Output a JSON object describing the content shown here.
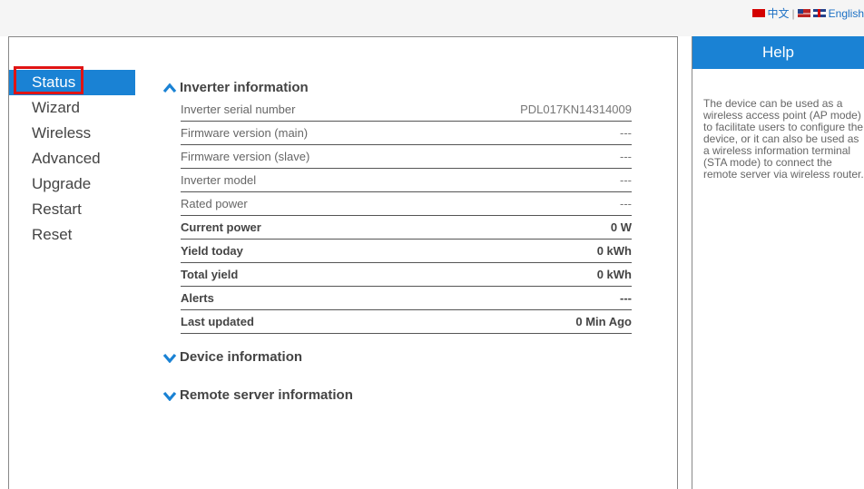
{
  "language": {
    "chinese": "中文",
    "separator": "|",
    "english": "English"
  },
  "nav": {
    "items": [
      {
        "label": "Status"
      },
      {
        "label": "Wizard"
      },
      {
        "label": "Wireless"
      },
      {
        "label": "Advanced"
      },
      {
        "label": "Upgrade"
      },
      {
        "label": "Restart"
      },
      {
        "label": "Reset"
      }
    ],
    "active": "Status"
  },
  "sections": {
    "inverter": {
      "title": "Inverter information",
      "expanded": true
    },
    "device": {
      "title": "Device information",
      "expanded": false
    },
    "remote": {
      "title": "Remote server information",
      "expanded": false
    }
  },
  "inverter_rows": [
    {
      "label": "Inverter serial number",
      "value": "PDL017KN14314009"
    },
    {
      "label": "Firmware version (main)",
      "value": "---"
    },
    {
      "label": "Firmware version (slave)",
      "value": "---"
    },
    {
      "label": "Inverter model",
      "value": "---"
    },
    {
      "label": "Rated power",
      "value": "---"
    },
    {
      "label": "Current power",
      "value": "0 W"
    },
    {
      "label": "Yield today",
      "value": "0 kWh"
    },
    {
      "label": "Total yield",
      "value": "0 kWh"
    },
    {
      "label": "Alerts",
      "value": "---"
    },
    {
      "label": "Last updated",
      "value": "0 Min Ago"
    }
  ],
  "help": {
    "title": "Help",
    "text": "The device can be used as a wireless access point (AP mode) to facilitate users to configure the device, or it can also be used as a wireless information terminal (STA mode) to connect the remote server via wireless router."
  },
  "colors": {
    "accent": "#1a82d4",
    "highlight_outline": "#e01414"
  },
  "icons": {
    "expanded": "chevron-up-icon",
    "collapsed": "chevron-down-icon",
    "flags": [
      "china-flag-icon",
      "us-flag-icon",
      "uk-flag-icon"
    ]
  }
}
